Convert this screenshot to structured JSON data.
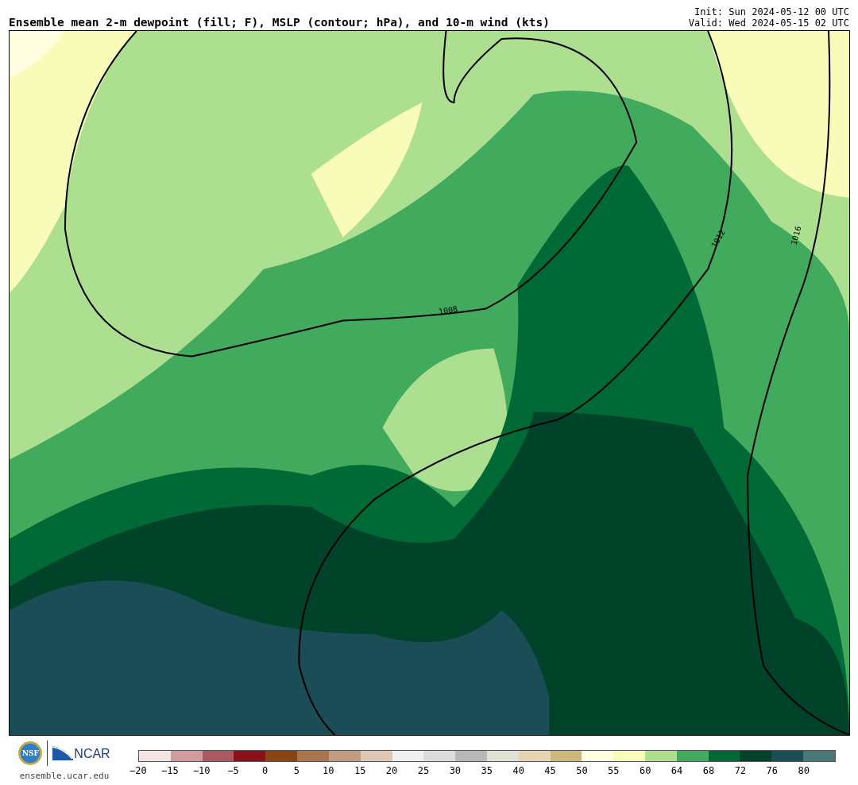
{
  "header": {
    "title": "Ensemble mean 2-m dewpoint (fill; F), MSLP (contour; hPa), and 10-m wind (kts)",
    "init": "Init: Sun 2024-05-12 00 UTC",
    "valid": "Valid: Wed 2024-05-15 02 UTC"
  },
  "map": {
    "contour_labels": [
      "1008",
      "1012",
      "1016"
    ]
  },
  "footer": {
    "nsf_logo": "NSF",
    "ncar_logo": "NCAR",
    "url": "ensemble.ucar.edu"
  },
  "legend": {
    "bins": [
      {
        "color": "#f2e4e4"
      },
      {
        "color": "#d09ca0"
      },
      {
        "color": "#ac5a60"
      },
      {
        "color": "#8b101c"
      },
      {
        "color": "#8a4414"
      },
      {
        "color": "#a8754f"
      },
      {
        "color": "#c49c80"
      },
      {
        "color": "#e0c7b3"
      },
      {
        "color": "#f0f0f0"
      },
      {
        "color": "#dcdcdc"
      },
      {
        "color": "#b8b8b8"
      },
      {
        "color": "#e0e2d4"
      },
      {
        "color": "#e5d4ae"
      },
      {
        "color": "#cdb87a"
      },
      {
        "color": "#fffee0"
      },
      {
        "color": "#f9fbb8"
      },
      {
        "color": "#addf91"
      },
      {
        "color": "#41aa5d"
      },
      {
        "color": "#006a36"
      },
      {
        "color": "#00432a"
      },
      {
        "color": "#1a4d55"
      },
      {
        "color": "#4a7878"
      }
    ],
    "ticks": [
      "−20",
      "−15",
      "−10",
      "−5",
      "0",
      "5",
      "10",
      "15",
      "20",
      "25",
      "30",
      "35",
      "40",
      "45",
      "50",
      "55",
      "60",
      "64",
      "68",
      "72",
      "76",
      "80"
    ]
  }
}
